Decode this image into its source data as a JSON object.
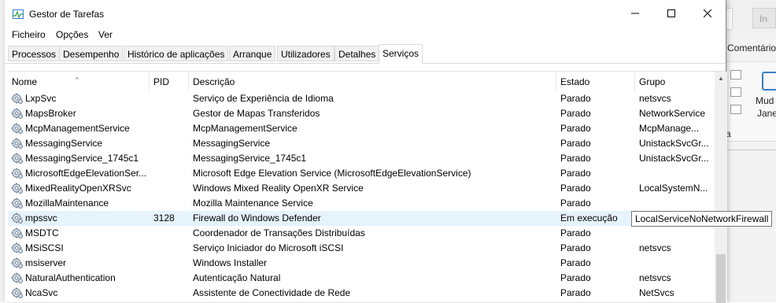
{
  "window": {
    "title": "Gestor de Tarefas",
    "controls": {
      "minimize": "—",
      "maximize": "☐",
      "close": "✕"
    }
  },
  "menu": [
    "Ficheiro",
    "Opções",
    "Ver"
  ],
  "tabs": [
    {
      "label": "Processos"
    },
    {
      "label": "Desempenho"
    },
    {
      "label": "Histórico de aplicações"
    },
    {
      "label": "Arranque"
    },
    {
      "label": "Utilizadores"
    },
    {
      "label": "Detalhes"
    },
    {
      "label": "Serviços",
      "active": true
    }
  ],
  "columns": {
    "name": "Nome",
    "pid": "PID",
    "description": "Descrição",
    "status": "Estado",
    "group": "Grupo"
  },
  "rows": [
    {
      "name": "LxpSvc",
      "pid": "",
      "description": "Serviço de Experiência de Idioma",
      "status": "Parado",
      "group": "netsvcs"
    },
    {
      "name": "MapsBroker",
      "pid": "",
      "description": "Gestor de Mapas Transferidos",
      "status": "Parado",
      "group": "NetworkService"
    },
    {
      "name": "McpManagementService",
      "pid": "",
      "description": "McpManagementService",
      "status": "Parado",
      "group": "McpManage..."
    },
    {
      "name": "MessagingService",
      "pid": "",
      "description": "MessagingService",
      "status": "Parado",
      "group": "UnistackSvcGr..."
    },
    {
      "name": "MessagingService_1745c1",
      "pid": "",
      "description": "MessagingService_1745c1",
      "status": "Parado",
      "group": "UnistackSvcGr..."
    },
    {
      "name": "MicrosoftEdgeElevationSer...",
      "pid": "",
      "description": "Microsoft Edge Elevation Service (MicrosoftEdgeElevationService)",
      "status": "Parado",
      "group": ""
    },
    {
      "name": "MixedRealityOpenXRSvc",
      "pid": "",
      "description": "Windows Mixed Reality OpenXR Service",
      "status": "Parado",
      "group": "LocalSystemN..."
    },
    {
      "name": "MozillaMaintenance",
      "pid": "",
      "description": "Mozilla Maintenance Service",
      "status": "Parado",
      "group": ""
    },
    {
      "name": "mpssvc",
      "pid": "3128",
      "description": "Firewall do Windows Defender",
      "status": "Em execução",
      "group": "",
      "selected": true
    },
    {
      "name": "MSDTC",
      "pid": "",
      "description": "Coordenador de Transações Distribuídas",
      "status": "Parado",
      "group": ""
    },
    {
      "name": "MSiSCSI",
      "pid": "",
      "description": "Serviço Iniciador do Microsoft iSCSI",
      "status": "Parado",
      "group": "netsvcs"
    },
    {
      "name": "msiserver",
      "pid": "",
      "description": "Windows Installer",
      "status": "Parado",
      "group": ""
    },
    {
      "name": "NaturalAuthentication",
      "pid": "",
      "description": "Autenticação Natural",
      "status": "Parado",
      "group": "netsvcs"
    },
    {
      "name": "NcaSvc",
      "pid": "",
      "description": "Assistente de Conectividade de Rede",
      "status": "Parado",
      "group": "NetSvcs"
    }
  ],
  "tooltip": "LocalServiceNoNetworkFirewall",
  "background_app": {
    "button_text": "In",
    "ribbon_tab": "Comentário",
    "ribbon_label_1": "Mud",
    "ribbon_label_2": "Jane",
    "side_text": "a"
  }
}
